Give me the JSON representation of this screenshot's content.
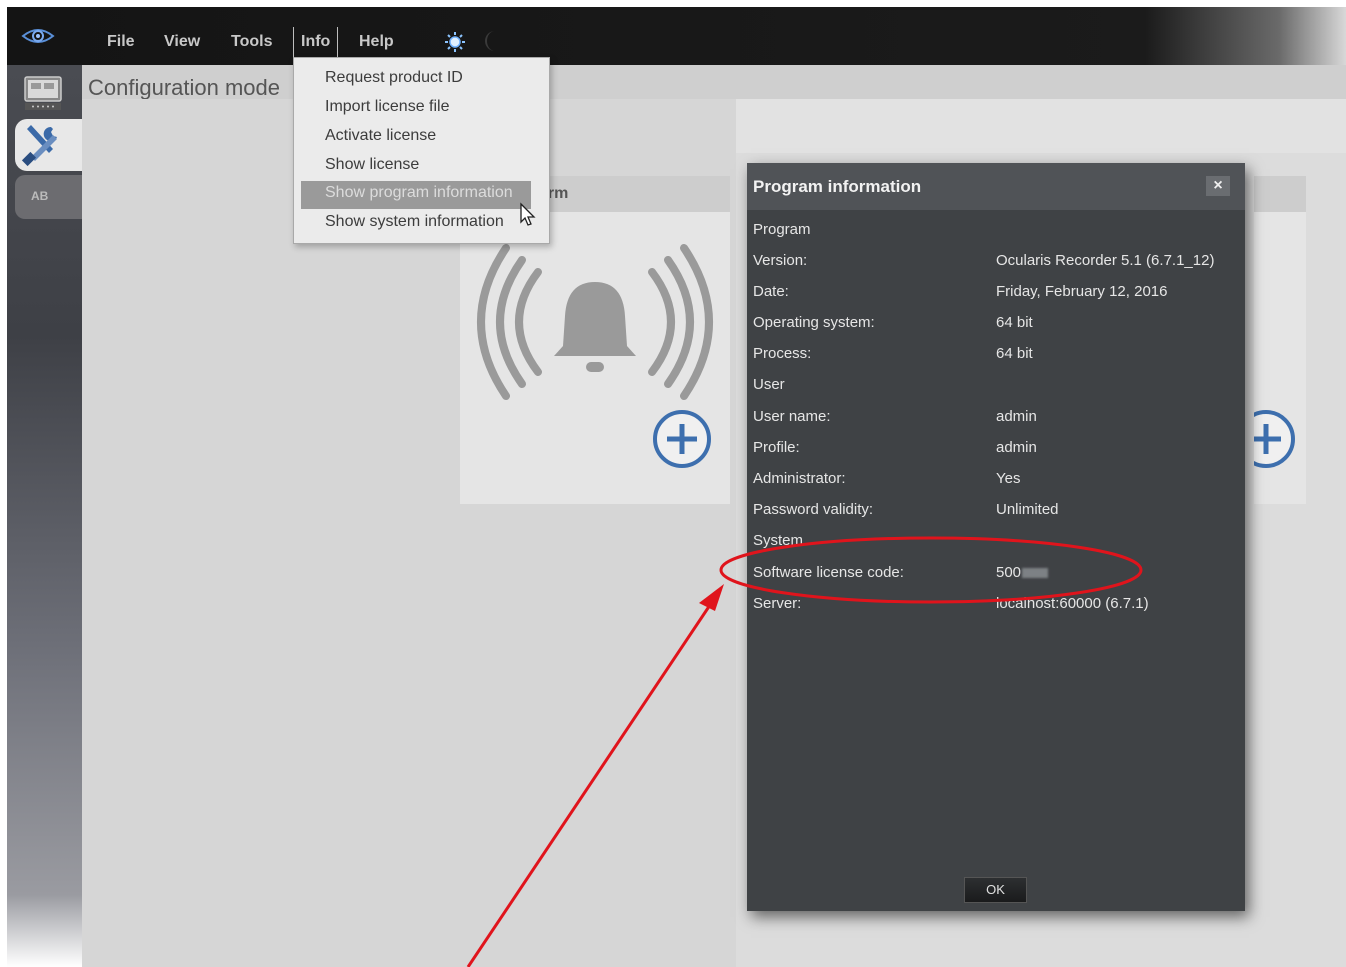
{
  "menubar": {
    "items": [
      "File",
      "View",
      "Tools",
      "Info",
      "Help"
    ]
  },
  "mode": {
    "title": "Configuration mode"
  },
  "sidebar": {
    "ab_label": "AB"
  },
  "card": {
    "title_partial": "arm"
  },
  "info_menu": {
    "items": [
      "Request product ID",
      "Import license file",
      "Activate license",
      "Show license",
      "Show program information",
      "Show system information"
    ],
    "highlighted_index": 4
  },
  "dialog": {
    "title": "Program information",
    "close_label": "×",
    "sections": {
      "program": "Program",
      "user": "User",
      "system": "System"
    },
    "rows": [
      {
        "label": "Version:",
        "value": "Ocularis Recorder 5.1 (6.7.1_12)"
      },
      {
        "label": "Date:",
        "value": "Friday, February 12, 2016"
      },
      {
        "label": "Operating system:",
        "value": "64 bit"
      },
      {
        "label": "Process:",
        "value": "64 bit"
      },
      {
        "label": "User name:",
        "value": "admin"
      },
      {
        "label": "Profile:",
        "value": "admin"
      },
      {
        "label": "Administrator:",
        "value": "Yes"
      },
      {
        "label": "Password validity:",
        "value": "Unlimited"
      },
      {
        "label": "Software license code:",
        "value": "500"
      },
      {
        "label": "Server:",
        "value": "localhost:60000 (6.7.1)"
      }
    ],
    "ok_label": "OK"
  },
  "colors": {
    "annotation": "#e0141c",
    "add_icon": "#3d6fae"
  },
  "icons": [
    "eye-logo-icon",
    "sun-icon",
    "moon-icon",
    "monitor-icon",
    "tools-icon",
    "alarm-bell-icon",
    "add-circle-icon",
    "mouse-cursor-icon"
  ]
}
